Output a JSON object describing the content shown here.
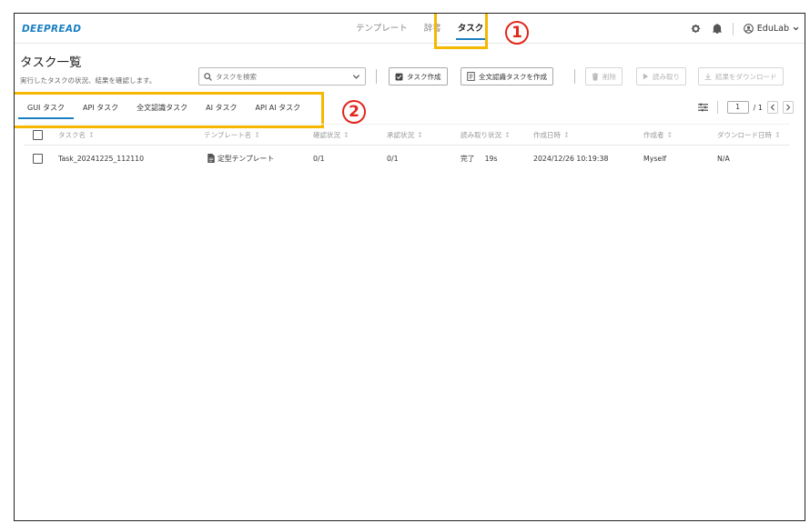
{
  "app": {
    "logo": "DEEPREAD",
    "nav": [
      "テンプレート",
      "辞書",
      "タスク"
    ],
    "user": "EduLab"
  },
  "annotations": {
    "marker1": "1",
    "marker2": "2"
  },
  "page": {
    "title": "タスク一覧",
    "subtitle": "実行したタスクの状況、結果を確認します。"
  },
  "toolbar": {
    "search_placeholder": "タスクを検索",
    "create_label": "タスク作成",
    "fulltext_label": "全文認識タスクを作成",
    "delete_label": "削除",
    "read_label": "読み取り",
    "download_label": "結果をダウンロード"
  },
  "tabs": [
    "GUI タスク",
    "API タスク",
    "全文認識タスク",
    "AI タスク",
    "API AI タスク"
  ],
  "pager": {
    "current": "1",
    "total": "/ 1"
  },
  "table": {
    "columns": [
      "タスク名",
      "テンプレート名",
      "確認状況",
      "承認状況",
      "読み取り状況",
      "作成日時",
      "作成者",
      "ダウンロード日時"
    ],
    "rows": [
      {
        "name": "Task_20241225_112110",
        "template": "定型テンプレート",
        "confirm": "0/1",
        "approve": "0/1",
        "read_status": "完了",
        "read_time": "19s",
        "created": "2024/12/26 10:19:38",
        "creator": "Myself",
        "download": "N/A"
      }
    ]
  },
  "colors": {
    "accent": "#1b7fc1",
    "highlight": "#f5b800",
    "marker": "#e2261b"
  }
}
